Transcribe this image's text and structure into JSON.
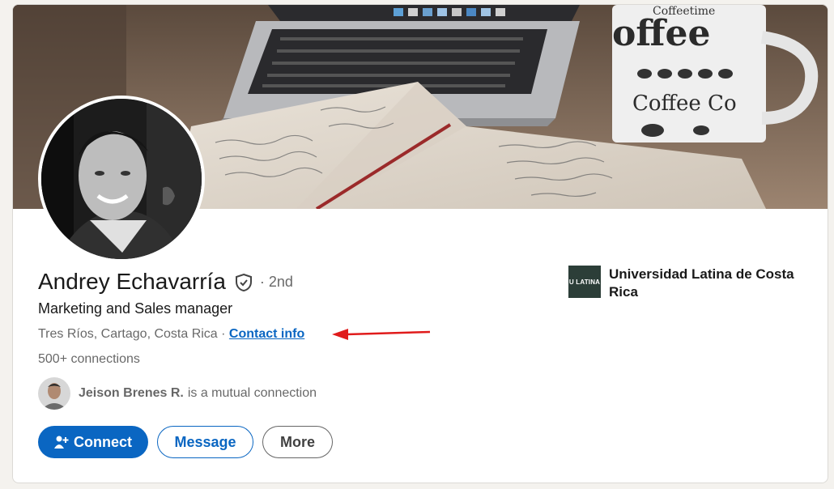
{
  "profile": {
    "name": "Andrey Echavarría",
    "degree": "· 2nd",
    "headline": "Marketing and Sales manager",
    "location": "Tres Ríos, Cartago, Costa Rica",
    "location_separator": " · ",
    "contact_info_label": "Contact info",
    "connections": "500+ connections",
    "verified_icon": "shield-check-icon"
  },
  "mutual": {
    "name": "Jeison Brenes R.",
    "suffix": "is a mutual connection"
  },
  "actions": {
    "connect_label": "Connect",
    "message_label": "Message",
    "more_label": "More"
  },
  "education": {
    "name": "Universidad Latina de Costa Rica",
    "logo_text": "U LATINA"
  },
  "banner": {
    "mug_text_1": "Coffeetime",
    "mug_text_2": "offee",
    "mug_text_3": "Coffee Co"
  },
  "colors": {
    "accent": "#0a66c2",
    "annotation_arrow": "#e01b1b"
  }
}
